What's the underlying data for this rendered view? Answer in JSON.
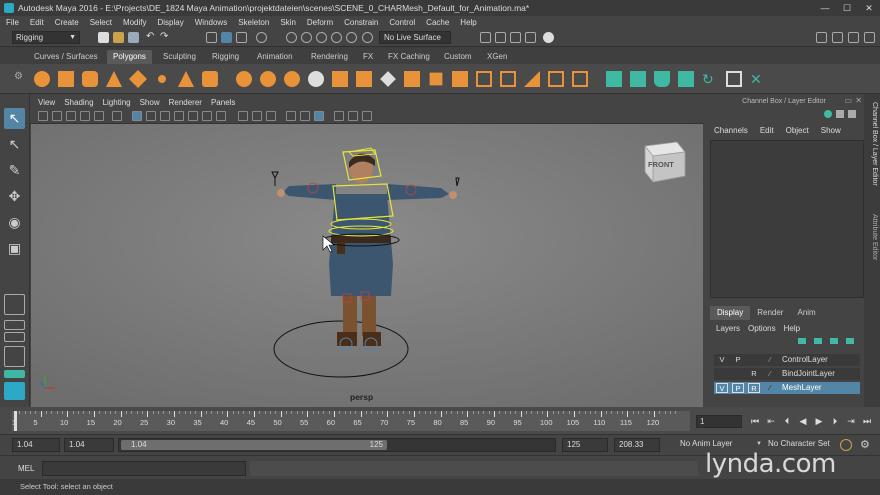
{
  "window": {
    "title": "Autodesk Maya 2016 - E:\\Projects\\DE_1824 Maya Animation\\projektdateien\\scenes\\SCENE_0_CHARMesh_Default_for_Animation.ma*",
    "controls": [
      "—",
      "☐",
      "✕"
    ]
  },
  "menubar": [
    "File",
    "Edit",
    "Create",
    "Select",
    "Modify",
    "Display",
    "Windows",
    "Skeleton",
    "Skin",
    "Deform",
    "Constrain",
    "Control",
    "Cache",
    "Help"
  ],
  "statusline": {
    "mode": "Rigging",
    "live_surface": "No Live Surface"
  },
  "shelf_tabs": [
    "Curves / Surfaces",
    "Polygons",
    "Sculpting",
    "Rigging",
    "Animation",
    "Rendering",
    "FX",
    "FX Caching",
    "Custom",
    "XGen"
  ],
  "shelf_active": "Polygons",
  "panel_menu": [
    "View",
    "Shading",
    "Lighting",
    "Show",
    "Renderer",
    "Panels"
  ],
  "viewport": {
    "camera_label": "persp",
    "viewcube_label": "FRONT"
  },
  "channel_box": {
    "title": "Channel Box / Layer Editor",
    "menu": [
      "Channels",
      "Edit",
      "Object",
      "Show"
    ]
  },
  "layer_editor": {
    "tabs": [
      "Display",
      "Render",
      "Anim"
    ],
    "active_tab": "Display",
    "menu": [
      "Layers",
      "Options",
      "Help"
    ],
    "layers": [
      {
        "v": "V",
        "p": "P",
        "r": "",
        "name": "ControlLayer",
        "selected": false
      },
      {
        "v": "",
        "p": "",
        "r": "R",
        "name": "BindJointLayer",
        "selected": false
      },
      {
        "v": "V",
        "p": "P",
        "r": "R",
        "name": "MeshLayer",
        "selected": true
      }
    ]
  },
  "side_tabs": [
    "Channel Box / Layer Editor",
    "Attribute Editor"
  ],
  "time_slider": {
    "tick_labels": [
      "1",
      "5",
      "10",
      "15",
      "20",
      "25",
      "30",
      "35",
      "40",
      "45",
      "50",
      "55",
      "60",
      "65",
      "70",
      "75",
      "80",
      "85",
      "90",
      "95",
      "100",
      "105",
      "110",
      "115",
      "120"
    ],
    "current_frame": "1"
  },
  "range_slider": {
    "start_time": "1.04",
    "playback_start": "1.04",
    "range_start_label": "1.04",
    "range_end_label": "125",
    "playback_end": "125",
    "end_time": "208.33",
    "anim_layer": "No Anim Layer",
    "character_set": "No Character Set"
  },
  "command_line": {
    "label": "MEL"
  },
  "help_line": "Select Tool: select an object",
  "watermark": "lynda.com",
  "colors": {
    "accent": "#5285a6",
    "shelf_orange": "#e8923a",
    "shelf_teal": "#3fb8a4",
    "rig_yellow": "#e6e63a"
  }
}
